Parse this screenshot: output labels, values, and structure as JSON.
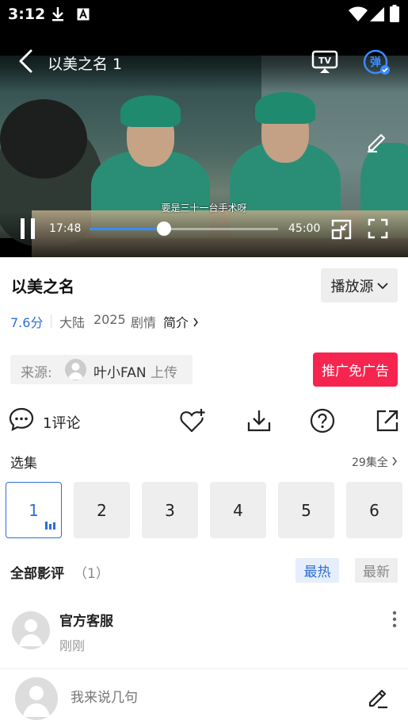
{
  "status_bar": {
    "time": "3:12",
    "icons": [
      "download-icon",
      "a-box-icon",
      "wifi-icon",
      "signal-icon",
      "battery-icon"
    ]
  },
  "player": {
    "title": "以美之名 1",
    "subtitle": "要是三十一台手术呀",
    "current_time": "17:48",
    "duration": "45:00",
    "progress": 0.396,
    "danmaku_label": "弹",
    "tv_label": "TV"
  },
  "info": {
    "show_title": "以美之名",
    "source_button": "播放源",
    "rating": "7.6分",
    "region": "大陆",
    "year": "2025",
    "genre": "剧情",
    "intro_link": "简介"
  },
  "uploader": {
    "label": "来源:",
    "name": "叶小FAN",
    "suffix": "上传"
  },
  "promo_button": "推广免广告",
  "actions": {
    "comment_label": "1评论"
  },
  "episodes": {
    "section_label": "选集",
    "total_label": "29集全",
    "items": [
      "1",
      "2",
      "3",
      "4",
      "5",
      "6"
    ],
    "active_index": 0
  },
  "reviews": {
    "section_label": "全部影评",
    "count": "（1）",
    "tab_hot": "最热",
    "tab_new": "最新",
    "items": [
      {
        "author": "官方客服",
        "time": "刚刚"
      }
    ]
  },
  "composer": {
    "placeholder": "我来说几句"
  },
  "colors": {
    "accent": "#2b6fd6",
    "promo": "#f5254f",
    "danmaku": "#3a8cff"
  }
}
